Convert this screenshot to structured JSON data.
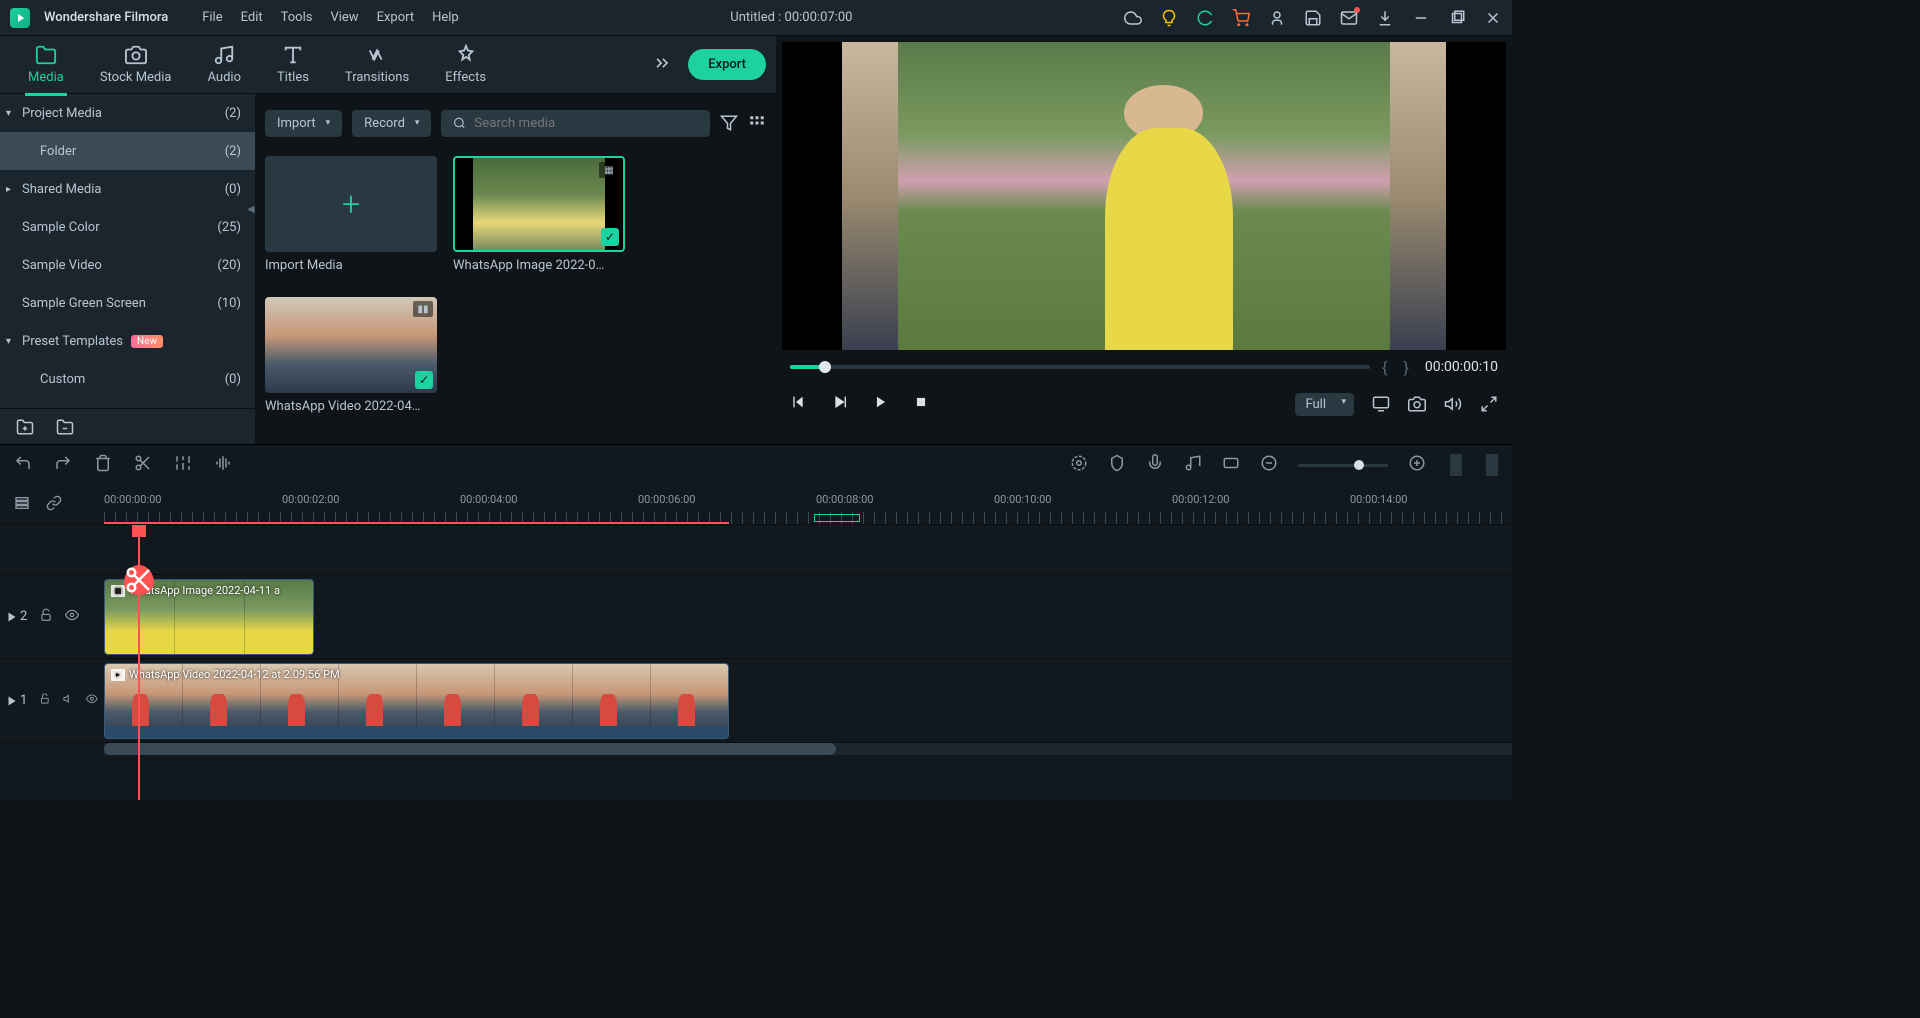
{
  "app": {
    "name": "Wondershare Filmora",
    "title": "Untitled : 00:00:07:00"
  },
  "menu": [
    "File",
    "Edit",
    "Tools",
    "View",
    "Export",
    "Help"
  ],
  "tabs": [
    {
      "label": "Media",
      "active": true
    },
    {
      "label": "Stock Media"
    },
    {
      "label": "Audio"
    },
    {
      "label": "Titles"
    },
    {
      "label": "Transitions"
    },
    {
      "label": "Effects"
    }
  ],
  "export_label": "Export",
  "sidebar": {
    "items": [
      {
        "label": "Project Media",
        "count": "(2)",
        "expanded": true
      },
      {
        "label": "Folder",
        "count": "(2)",
        "child": true,
        "selected": true
      },
      {
        "label": "Shared Media",
        "count": "(0)",
        "collapsed": true
      },
      {
        "label": "Sample Color",
        "count": "(25)"
      },
      {
        "label": "Sample Video",
        "count": "(20)"
      },
      {
        "label": "Sample Green Screen",
        "count": "(10)"
      },
      {
        "label": "Preset Templates",
        "badge": "New",
        "expanded": true
      },
      {
        "label": "Custom",
        "count": "(0)",
        "child": true
      }
    ]
  },
  "media_toolbar": {
    "import": "Import",
    "record": "Record",
    "search_placeholder": "Search media"
  },
  "media_items": {
    "import_label": "Import Media",
    "item1_label": "WhatsApp Image 2022-0…",
    "item2_label": "WhatsApp Video 2022-04…"
  },
  "preview": {
    "timecode": "00:00:00:10",
    "brackets_in": "{",
    "brackets_out": "}",
    "quality": "Full"
  },
  "timeline": {
    "ruler": [
      "00:00:00:00",
      "00:00:02:00",
      "00:00:04:00",
      "00:00:06:00",
      "00:00:08:00",
      "00:00:10:00",
      "00:00:12:00",
      "00:00:14:00"
    ],
    "track2": {
      "label": "2",
      "clip_label": "WhatsApp Image 2022-04-11 a"
    },
    "track1": {
      "label": "1",
      "clip_label": "WhatsApp Video 2022-04-12 at 2.09.56 PM"
    }
  }
}
